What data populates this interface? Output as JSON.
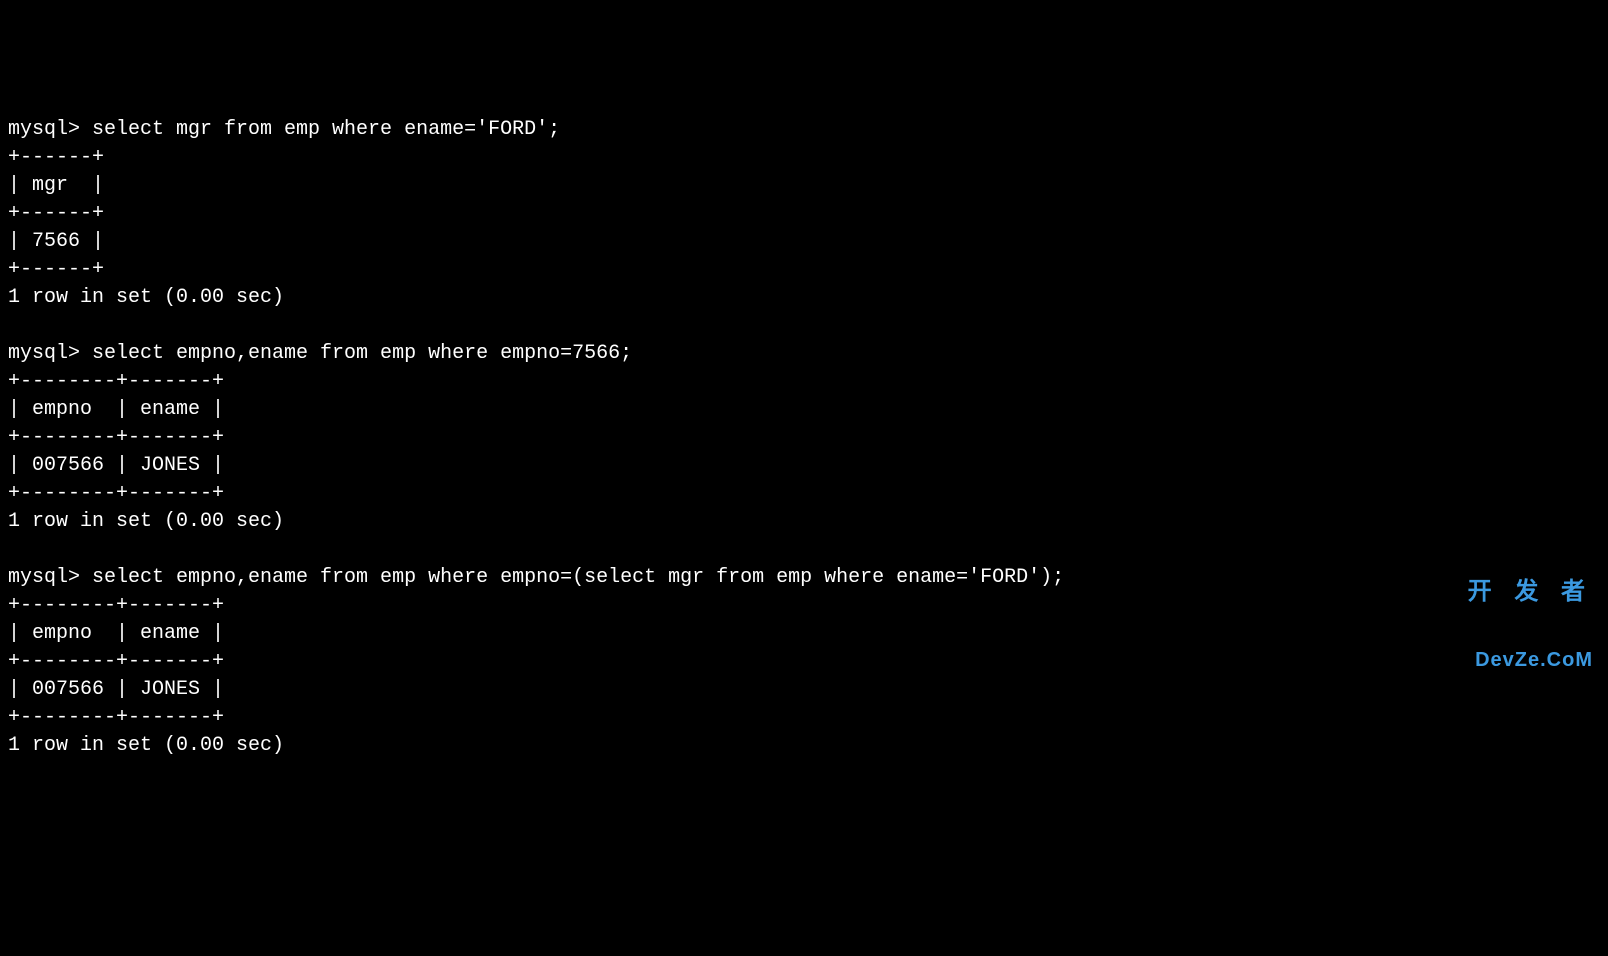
{
  "terminal": {
    "lines": [
      "mysql> select mgr from emp where ename='FORD';",
      "+------+",
      "| mgr  |",
      "+------+",
      "| 7566 |",
      "+------+",
      "1 row in set (0.00 sec)",
      "",
      "mysql> select empno,ename from emp where empno=7566;",
      "+--------+-------+",
      "| empno  | ename |",
      "+--------+-------+",
      "| 007566 | JONES |",
      "+--------+-------+",
      "1 row in set (0.00 sec)",
      "",
      "mysql> select empno,ename from emp where empno=(select mgr from emp where ename='FORD');",
      "+--------+-------+",
      "| empno  | ename |",
      "+--------+-------+",
      "| 007566 | JONES |",
      "+--------+-------+",
      "1 row in set (0.00 sec)"
    ]
  },
  "watermark": {
    "top": "开 发 者",
    "bottom": "DevZe.CoM"
  }
}
